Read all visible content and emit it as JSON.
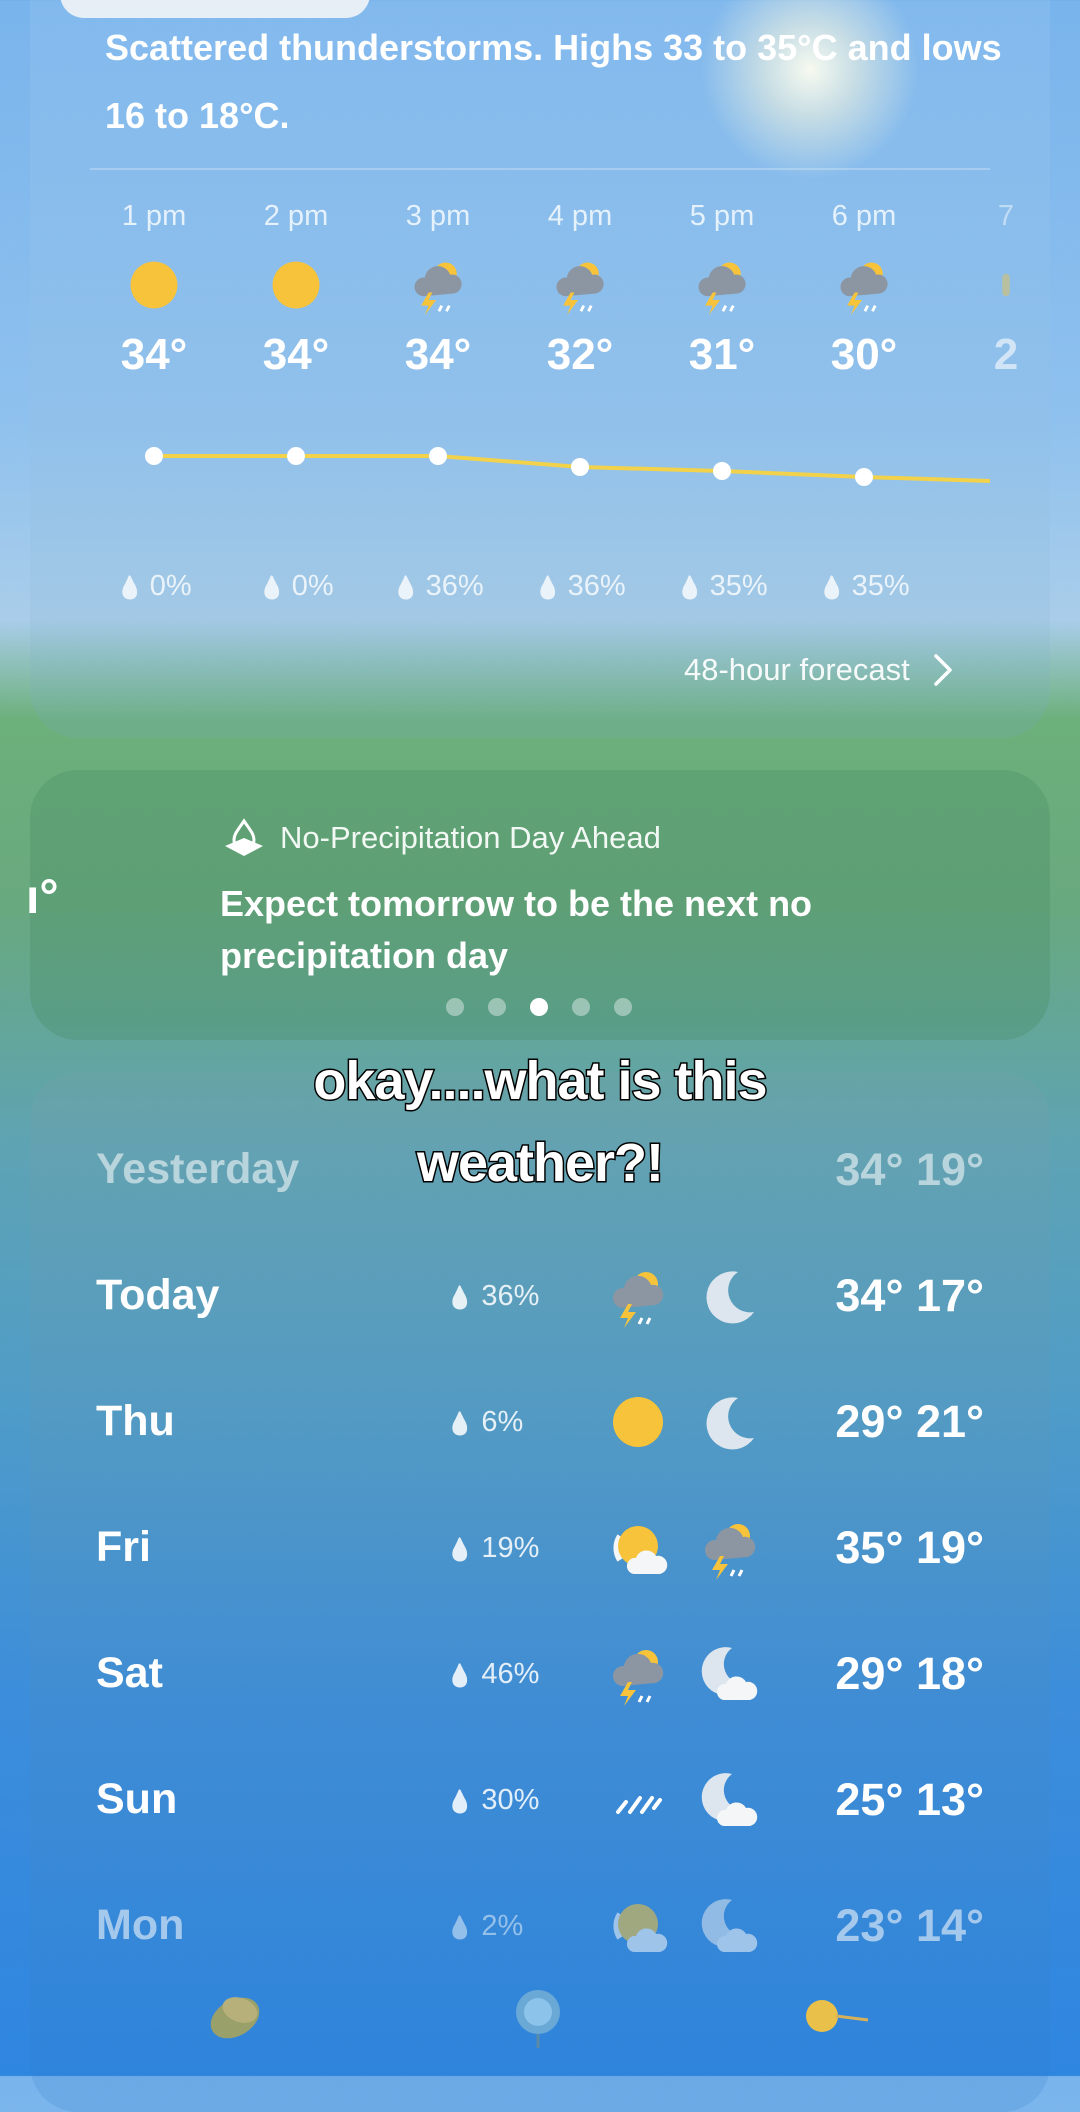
{
  "summary": "Scattered thunderstorms. Highs 33 to 35°C and lows 16 to 18°C.",
  "hourly": [
    {
      "time": "1 pm",
      "icon": "sun-icon",
      "temp": "34°",
      "precip": "0%"
    },
    {
      "time": "2 pm",
      "icon": "sun-icon",
      "temp": "34°",
      "precip": "0%"
    },
    {
      "time": "3 pm",
      "icon": "thunderstorm-icon",
      "temp": "34°",
      "precip": "36%"
    },
    {
      "time": "4 pm",
      "icon": "thunderstorm-icon",
      "temp": "32°",
      "precip": "36%"
    },
    {
      "time": "5 pm",
      "icon": "thunderstorm-icon",
      "temp": "31°",
      "precip": "35%"
    },
    {
      "time": "6 pm",
      "icon": "thunderstorm-icon",
      "temp": "30°",
      "precip": "35%"
    },
    {
      "time": "7",
      "icon": "partial-icon",
      "temp": "2",
      "precip": ""
    }
  ],
  "forecast_link": "48-hour forecast",
  "insight": {
    "title": "No-Precipitation Day Ahead",
    "body": "Expect tomorrow to be the next no precipitation day",
    "side_fragment": "ı°",
    "dots_total": 5,
    "dots_active_index": 2
  },
  "caption": "okay....what is this weather?!",
  "daily": [
    {
      "day": "Yesterday",
      "precip": "",
      "icon_day": "",
      "icon_night": "",
      "temps": "34° 19°",
      "faded": true
    },
    {
      "day": "Today",
      "precip": "36%",
      "icon_day": "thunderstorm-icon",
      "icon_night": "moon-icon",
      "temps": "34° 17°",
      "faded": false
    },
    {
      "day": "Thu",
      "precip": "6%",
      "icon_day": "sun-icon",
      "icon_night": "moon-icon",
      "temps": "29° 21°",
      "faded": false
    },
    {
      "day": "Fri",
      "precip": "19%",
      "icon_day": "partly-cloudy-icon",
      "icon_night": "thunderstorm-icon",
      "temps": "35° 19°",
      "faded": false
    },
    {
      "day": "Sat",
      "precip": "46%",
      "icon_day": "thunderstorm-icon",
      "icon_night": "moon-cloud-icon",
      "temps": "29° 18°",
      "faded": false
    },
    {
      "day": "Sun",
      "precip": "30%",
      "icon_day": "rain-icon",
      "icon_night": "moon-cloud-icon",
      "temps": "25° 13°",
      "faded": false
    },
    {
      "day": "Mon",
      "precip": "2%",
      "icon_day": "partly-cloudy-icon",
      "icon_night": "moon-cloud-icon",
      "temps": "23° 14°",
      "faded": true
    }
  ],
  "bottom_icons": [
    "leaf-icon",
    "flower-icon",
    "dandelion-icon"
  ],
  "colors": {
    "sun": "#f7c33a",
    "line": "#f2d24a",
    "cloud": "#8c96a3"
  }
}
